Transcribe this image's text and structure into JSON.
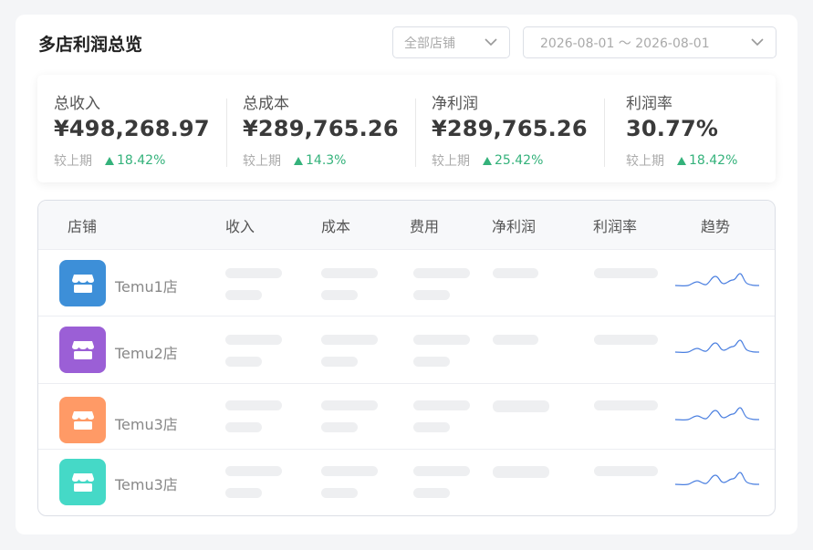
{
  "header": {
    "title": "多店利润总览",
    "shop_select": "全部店铺",
    "date_range": "2026-08-01 ～ 2026-08-01"
  },
  "stats": [
    {
      "label": "总收入",
      "value": "¥498,268.97",
      "compare_label": "较上期",
      "change": "18.42%"
    },
    {
      "label": "总成本",
      "value": "¥289,765.26",
      "compare_label": "较上期",
      "change": "14.3%"
    },
    {
      "label": "净利润",
      "value": "¥289,765.26",
      "compare_label": "较上期",
      "change": "25.42%"
    },
    {
      "label": "利润率",
      "value": "30.77%",
      "compare_label": "较上期",
      "change": "18.42%"
    }
  ],
  "table": {
    "columns": [
      "店铺",
      "收入",
      "成本",
      "费用",
      "净利润",
      "利润率",
      "趋势"
    ],
    "rows": [
      {
        "shop": "Temu1店",
        "icon_color": "#3d8fd8"
      },
      {
        "shop": "Temu2店",
        "icon_color": "#9b5fd6"
      },
      {
        "shop": "Temu3店",
        "icon_color": "#ff9a66"
      },
      {
        "shop": "Temu3店",
        "icon_color": "#45d9c7"
      }
    ]
  },
  "colors": {
    "accent_up": "#34b27b",
    "sparkline": "#4a7fe0"
  },
  "icons": {
    "shop": "storefront-icon",
    "dropdown": "chevron-down-icon",
    "trend_up": "triangle-up-icon"
  }
}
